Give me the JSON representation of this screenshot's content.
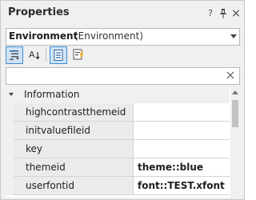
{
  "window": {
    "title": "Properties",
    "help_label": "?",
    "pin_icon": "pin-icon",
    "close_label": "×"
  },
  "object_selector": {
    "name": "Environment",
    "type": "(Environment)"
  },
  "toolbar": {
    "buttons": [
      {
        "name": "categorized-icon",
        "active": true
      },
      {
        "name": "alphabetical-icon",
        "active": false
      },
      {
        "name": "properties-icon",
        "active": true
      },
      {
        "name": "events-icon",
        "active": false
      }
    ]
  },
  "search": {
    "value": "",
    "placeholder": ""
  },
  "grid": {
    "category": "Information",
    "rows": [
      {
        "name": "highcontrastthemeid",
        "value": "",
        "bold": false
      },
      {
        "name": "initvaluefileid",
        "value": "",
        "bold": false
      },
      {
        "name": "key",
        "value": "",
        "bold": false
      },
      {
        "name": "themeid",
        "value": "theme::blue",
        "bold": true
      },
      {
        "name": "userfontid",
        "value": "font::TEST.xfont",
        "bold": true
      }
    ]
  },
  "colors": {
    "accent": "#3d8fd6",
    "panel_bg": "#f0f0f0",
    "name_cell_bg": "#ebebeb"
  }
}
